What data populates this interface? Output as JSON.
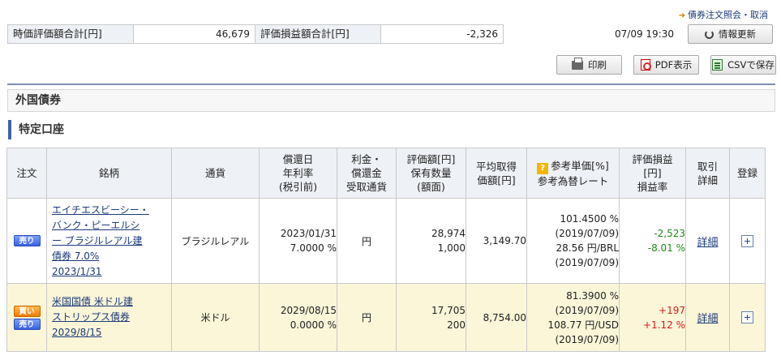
{
  "header": {
    "top_link": "債券注文照会・取消",
    "summary": {
      "market_value_label": "時価評価額合計[円]",
      "market_value": "46,679",
      "pnl_label": "評価損益額合計[円]",
      "pnl": "-2,326"
    },
    "update_time": "07/09 19:30",
    "refresh_label": "情報更新"
  },
  "toolbar": {
    "print_label": "印刷",
    "pdf_label": "PDF表示",
    "csv_label": "CSVで保存"
  },
  "section": {
    "title": "外国債券",
    "subtitle": "特定口座"
  },
  "table": {
    "headers": {
      "order": "注文",
      "name": "銘柄",
      "currency": "通貨",
      "maturity": [
        "償還日",
        "年利率",
        "(税引前)"
      ],
      "settlement": [
        "利金・",
        "償還金",
        "受取通貨"
      ],
      "valuation": [
        "評価額[円]",
        "保有数量",
        "(額面)"
      ],
      "avg_cost": [
        "平均取得",
        "価額[円]"
      ],
      "ref_price": [
        "参考単価[%]",
        "参考為替レート"
      ],
      "pnl": [
        "評価損益",
        "[円]",
        "損益率"
      ],
      "trade_detail": [
        "取引",
        "詳細"
      ],
      "register": "登録"
    },
    "rows": [
      {
        "badges": [
          "売り"
        ],
        "name": [
          "エイチエスビーシー・",
          "バンク・ピーエルシ",
          "ー ブラジルレアル建",
          "債券 7.0%",
          "2023/1/31"
        ],
        "currency": "ブラジルレアル",
        "maturity": "2023/01/31",
        "rate": "7.0000 %",
        "settlement": "円",
        "valuation": "28,974",
        "quantity": "1,000",
        "avg_cost": "3,149.70",
        "ref_price": "101.4500 %",
        "ref_price_date": "(2019/07/09)",
        "fx_rate": "28.56 円/BRL",
        "fx_date": "(2019/07/09)",
        "pnl": "-2,523",
        "pnl_rate": "-8.01 %",
        "detail": "詳細"
      },
      {
        "badges": [
          "買い",
          "売り"
        ],
        "name": [
          "米国国債 米ドル建",
          "ストリップス債券",
          "2029/8/15"
        ],
        "currency": "米ドル",
        "maturity": "2029/08/15",
        "rate": "0.0000 %",
        "settlement": "円",
        "valuation": "17,705",
        "quantity": "200",
        "avg_cost": "8,754.00",
        "ref_price": "81.3900 %",
        "ref_price_date": "(2019/07/09)",
        "fx_rate": "108.77 円/USD",
        "fx_date": "(2019/07/09)",
        "pnl": "+197",
        "pnl_rate": "+1.12 %",
        "detail": "詳細"
      }
    ]
  },
  "icons": {
    "refresh": "refresh-icon",
    "print": "printer-icon",
    "pdf": "pdf-icon",
    "csv": "csv-icon",
    "help": "help-icon",
    "register": "plus-icon"
  },
  "colors": {
    "gain": "#d61a1a",
    "loss": "#1a8a1a",
    "header_bg": "#eef1f6",
    "highlight_row": "#fbf6d8",
    "accent": "#3d62a8"
  }
}
